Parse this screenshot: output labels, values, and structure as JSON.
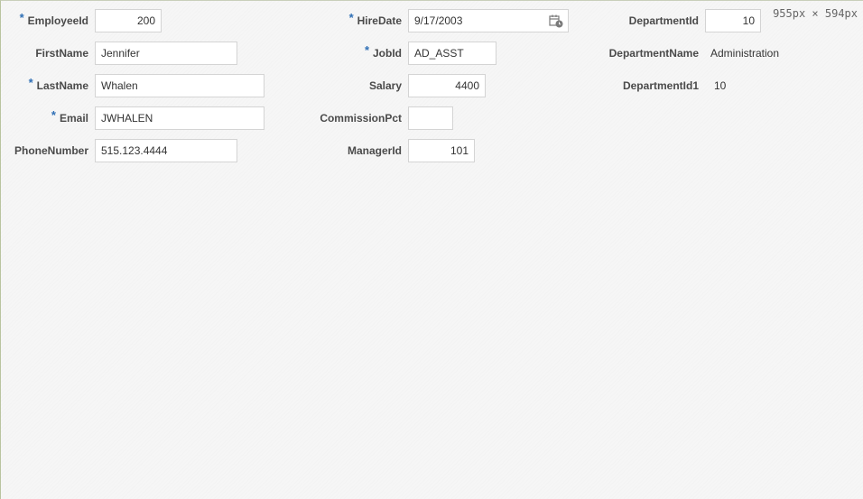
{
  "overlay": {
    "dimensions": "955px × 594px"
  },
  "form": {
    "employee_id": {
      "label": "EmployeeId",
      "value": "200",
      "required": "*"
    },
    "first_name": {
      "label": "FirstName",
      "value": "Jennifer"
    },
    "last_name": {
      "label": "LastName",
      "value": "Whalen",
      "required": "*"
    },
    "email": {
      "label": "Email",
      "value": "JWHALEN",
      "required": "*"
    },
    "phone_number": {
      "label": "PhoneNumber",
      "value": "515.123.4444"
    },
    "hire_date": {
      "label": "HireDate",
      "value": "9/17/2003",
      "required": "*",
      "icon": "calendar-clock-icon"
    },
    "job_id": {
      "label": "JobId",
      "value": "AD_ASST",
      "required": "*"
    },
    "salary": {
      "label": "Salary",
      "value": "4400"
    },
    "commission_pct": {
      "label": "CommissionPct",
      "value": ""
    },
    "manager_id": {
      "label": "ManagerId",
      "value": "101"
    },
    "department_id": {
      "label": "DepartmentId",
      "value": "10"
    },
    "department_name": {
      "label": "DepartmentName",
      "value": "Administration"
    },
    "department_id1": {
      "label": "DepartmentId1",
      "value": "10"
    }
  },
  "colors": {
    "required_marker": "#2f6fb5",
    "background": "#f6f6f6",
    "input_border": "#d4d4d4"
  }
}
